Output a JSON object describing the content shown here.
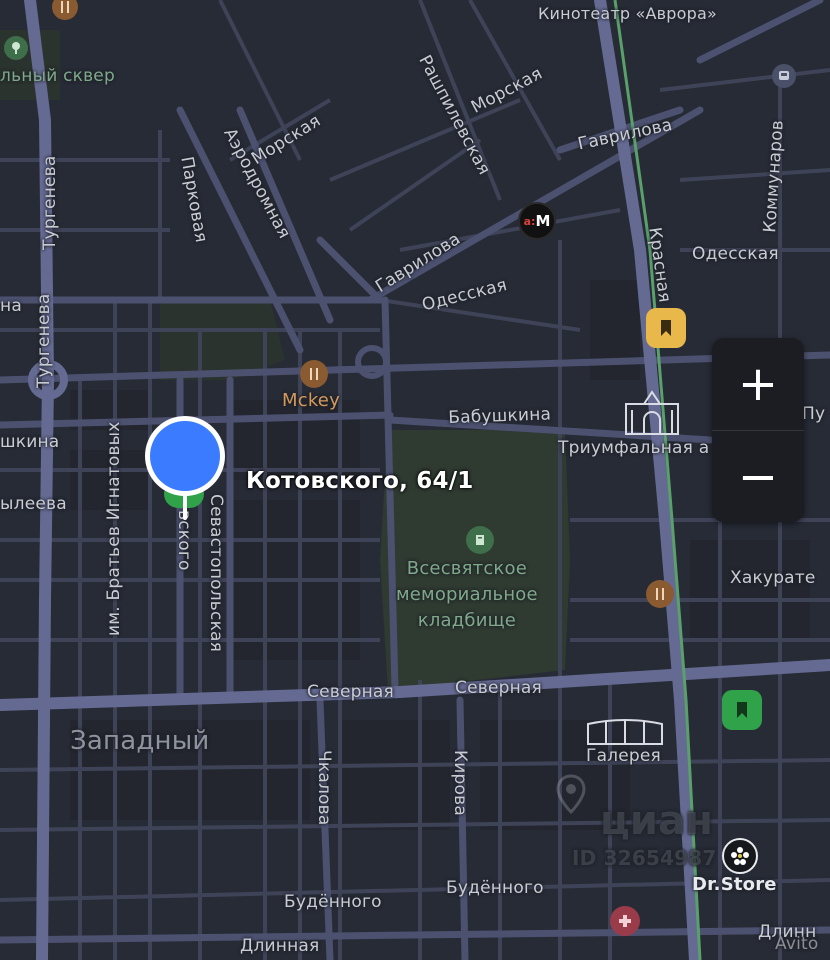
{
  "streets": {
    "kinoteatr": "Кинотеатр «Аврора»",
    "skver": "льный сквер",
    "turgeneva_top": "Тургенева",
    "turgeneva_mid": "Тургенева",
    "morskaya_1": "Морская",
    "morskaya_2": "Морская",
    "parkovaya": "Парковая",
    "aerodromnaya": "Аэродромная",
    "rashpilevskaya": "Рашпилевская",
    "gavrilova_1": "Гаврилова",
    "gavrilova_2": "Гаврилова",
    "kommunarov": "Коммунаров",
    "odesskaya_1": "Одесская",
    "odesskaya_2": "Одесская",
    "krasnaya": "Красная",
    "babushkina_left": "шкина",
    "babushkina": "Бабушкина",
    "na_left": "на",
    "yleeva": "ылеева",
    "ignatovykh": "им. Братьев Игнатовых",
    "kotovskogo_vert": "вского",
    "sevastopolskaya": "Севастопольская",
    "triumfalnaya": "Триумфальная а",
    "pu": "Пу",
    "khakurate": "Хакурате",
    "severnaya_1": "Северная",
    "severnaya_2": "Северная",
    "galereya": "Галерея",
    "chkalova": "Чкалова",
    "kirova": "Кирова",
    "budennogo_1": "Будённого",
    "budennogo_2": "Будённого",
    "dlinnaya_1": "Длинная",
    "dlinnaya_2": "Длинн"
  },
  "places": {
    "mckey": "Mckey",
    "cemetery": "Всесвятское\nмемориальное\nкладбище",
    "district": "Западный",
    "address": "Котовского, 64/1",
    "dr_store": "Dr.Store",
    "metro_badge": "М"
  },
  "watermark": {
    "brand": "циан",
    "id": "ID 32654987",
    "avito": "Avito"
  },
  "zoom": {
    "plus": "+",
    "minus": "−"
  },
  "colors": {
    "background": "#272b35",
    "road": "#4a4e66",
    "arterial": "#6a6f95",
    "park": "#2f3a31",
    "pin": "#3a7bff",
    "bookmark_yellow": "#e8b84a",
    "bookmark_green": "#2fa24a"
  }
}
